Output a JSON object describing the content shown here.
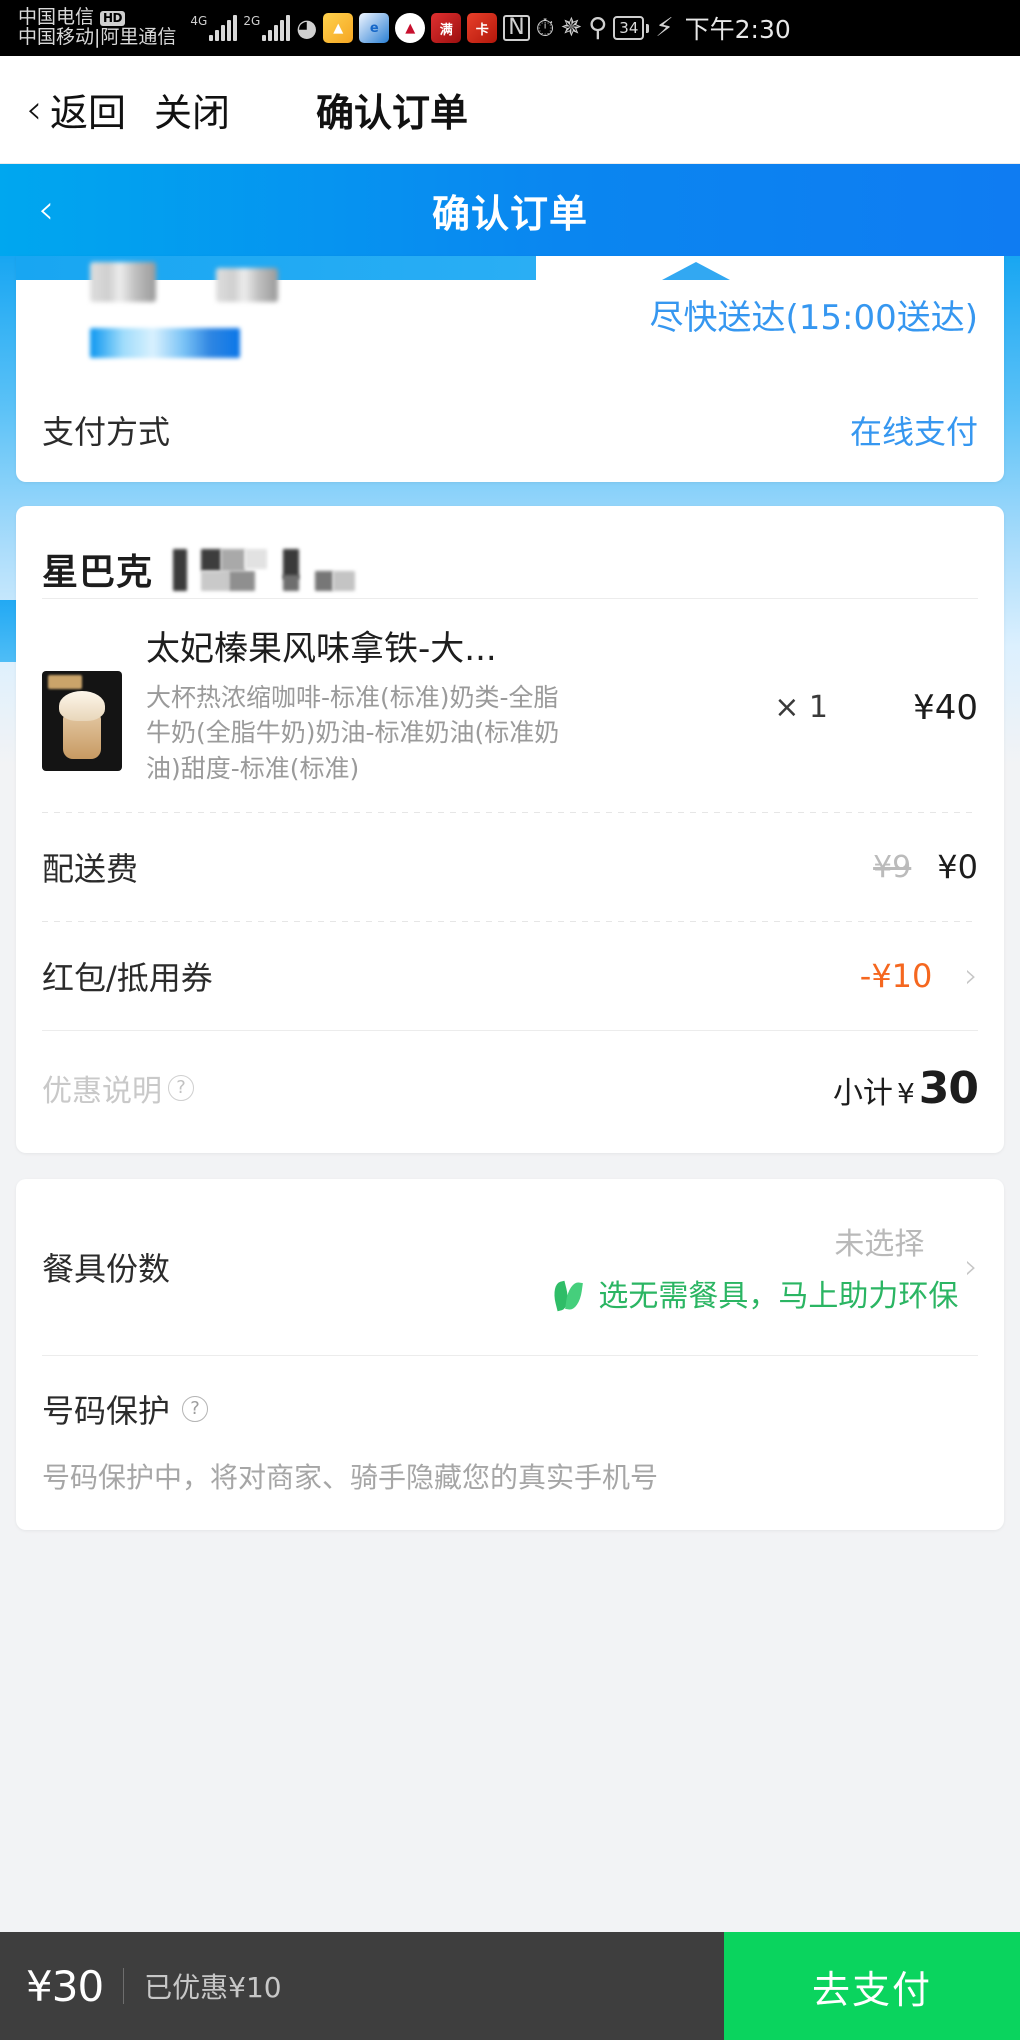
{
  "statusbar": {
    "carrier_primary": "中国电信",
    "hd_badge": "HD",
    "carrier_secondary": "中国移动|阿里通信",
    "net_primary": "4G",
    "net_secondary": "2G",
    "icons": [
      "wifi-icon",
      "app-icon-yellow",
      "app-icon-blue",
      "app-icon-red",
      "app-icon-crimson",
      "app-icon-scarlet",
      "nfc-icon",
      "alarm-icon",
      "bluetooth-icon",
      "location-icon"
    ],
    "battery_level": "34",
    "charging": true,
    "time": "下午2:30"
  },
  "webnav": {
    "back_label": "返回",
    "close_label": "关闭",
    "title": "确认订单"
  },
  "appbar": {
    "title": "确认订单",
    "back_icon": "chevron-left-icon"
  },
  "address": {
    "eta": "尽快送达(15:00送达)"
  },
  "payment": {
    "label": "支付方式",
    "value": "在线支付"
  },
  "store": {
    "name": "星巴克"
  },
  "item": {
    "title": "太妃榛果风味拿铁-大...",
    "desc": "大杯热浓缩咖啡-标准(标准)奶类-全脂牛奶(全脂牛奶)奶油-标准奶油(标准奶油)甜度-标准(标准)",
    "qty": "× 1",
    "price": "¥40"
  },
  "delivery_fee": {
    "label": "配送费",
    "original": "¥9",
    "current": "¥0"
  },
  "coupon": {
    "label": "红包/抵用券",
    "value": "-¥10",
    "chevron": "chevron-right-icon"
  },
  "subtotal": {
    "note": "优惠说明",
    "note_icon": "question-mark-icon",
    "label": "小计",
    "currency": "¥",
    "amount": "30"
  },
  "tableware": {
    "label": "餐具份数",
    "status": "未选择",
    "eco_text": "选无需餐具，马上助力环保",
    "eco_icon": "leaf-icon",
    "chevron": "chevron-right-icon"
  },
  "phone_protection": {
    "title": "号码保护",
    "icon": "question-mark-icon",
    "description": "号码保护中，将对商家、骑手隐藏您的真实手机号"
  },
  "bottombar": {
    "total": "¥30",
    "saved": "已优惠¥10",
    "pay_label": "去支付"
  },
  "colors": {
    "brand_blue": "#0a86f0",
    "link_blue": "#3697f0",
    "discount_orange": "#f5671f",
    "eco_green": "#2bb563",
    "pay_green": "#0ad45e",
    "bottom_dark": "#3e3e3e"
  }
}
